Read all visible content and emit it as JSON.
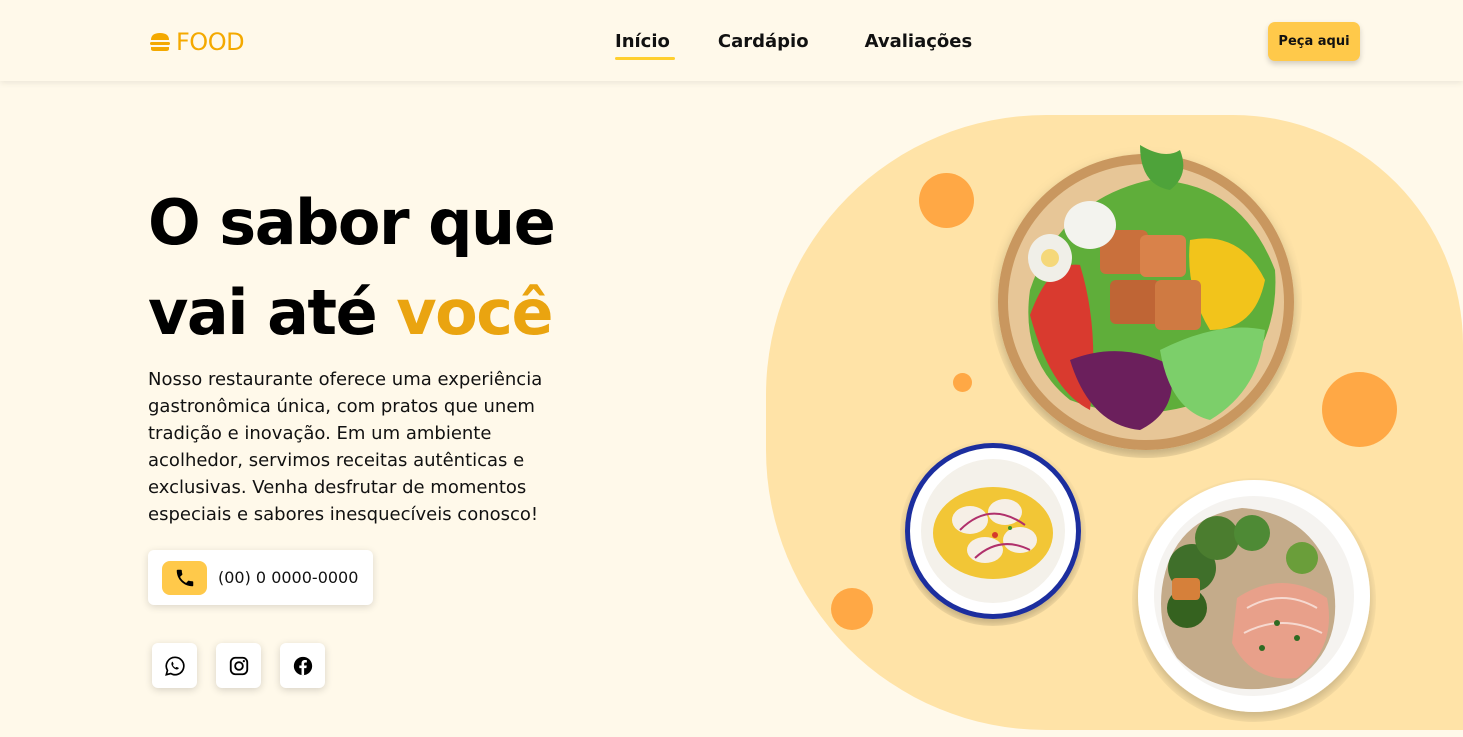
{
  "brand": {
    "name": "FOOD",
    "color": "#f4a900"
  },
  "nav": {
    "items": [
      {
        "label": "Início",
        "active": true
      },
      {
        "label": "Cardápio",
        "active": false
      },
      {
        "label": "Avaliações",
        "active": false
      }
    ],
    "cta_label": "Peça aqui"
  },
  "hero": {
    "title_line1": "O sabor que",
    "title_line2_prefix": "vai até ",
    "title_accent": "você",
    "description": "Nosso restaurante oferece uma experiência gastronômica única, com pratos que unem tradição e inovação. Em um ambiente acolhedor, servimos receitas autênticas e exclusivas. Venha desfrutar de momentos especiais e sabores inesquecíveis conosco!",
    "phone": "(00) 0 0000-0000"
  },
  "social": [
    {
      "icon": "whatsapp-icon"
    },
    {
      "icon": "instagram-icon"
    },
    {
      "icon": "facebook-icon"
    }
  ],
  "colors": {
    "background": "#fff9ea",
    "accent": "#eaa410",
    "button": "#ffc94a",
    "blob": "#ffe3a7",
    "dots": "#ffa845"
  }
}
